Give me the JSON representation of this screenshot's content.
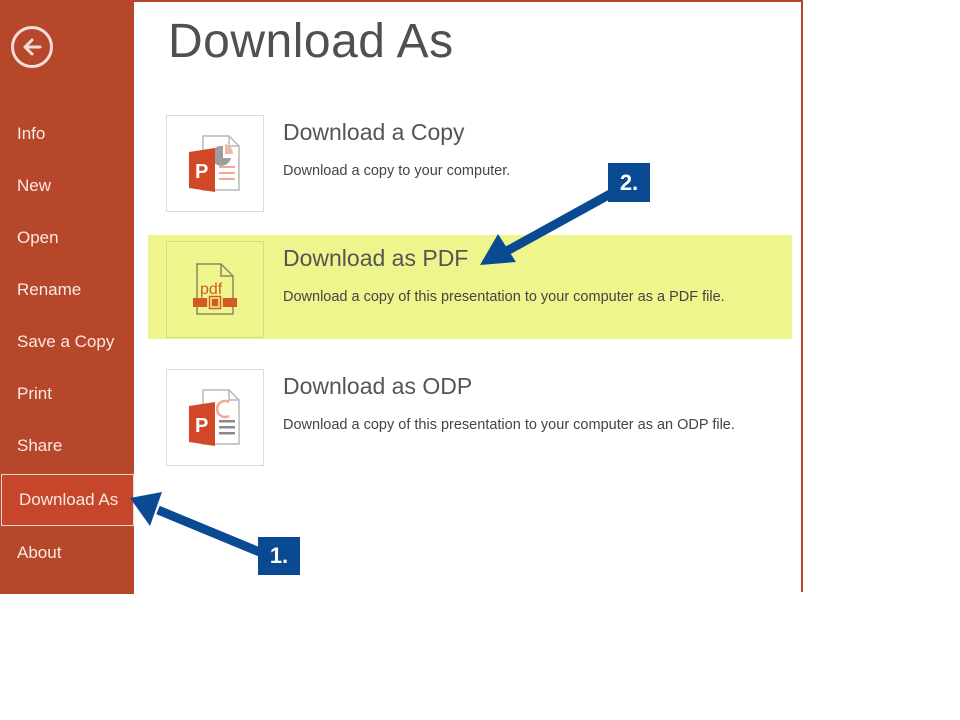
{
  "page": {
    "title": "Download As"
  },
  "sidebar": {
    "back_icon": "back-arrow-circle-icon",
    "items": [
      {
        "label": "Info",
        "active": false
      },
      {
        "label": "New",
        "active": false
      },
      {
        "label": "Open",
        "active": false
      },
      {
        "label": "Rename",
        "active": false
      },
      {
        "label": "Save a Copy",
        "active": false
      },
      {
        "label": "Print",
        "active": false
      },
      {
        "label": "Share",
        "active": false
      },
      {
        "label": "Download As",
        "active": true
      },
      {
        "label": "About",
        "active": false
      }
    ]
  },
  "options": [
    {
      "title": "Download a Copy",
      "description": "Download a copy to your computer.",
      "icon": "powerpoint-file-icon",
      "highlighted": false
    },
    {
      "title": "Download as PDF",
      "description": "Download a copy of this presentation to your computer as a PDF file.",
      "icon": "pdf-file-icon",
      "highlighted": true
    },
    {
      "title": "Download as ODP",
      "description": "Download a copy of this presentation to your computer as an ODP file.",
      "icon": "odp-file-icon",
      "highlighted": false
    }
  ],
  "annotations": [
    {
      "label": "1.",
      "points_to": "Download As"
    },
    {
      "label": "2.",
      "points_to": "Download as PDF"
    }
  ],
  "colors": {
    "sidebar": "#b7472a",
    "highlight": "#eef58c",
    "callout": "#0a4a92"
  }
}
